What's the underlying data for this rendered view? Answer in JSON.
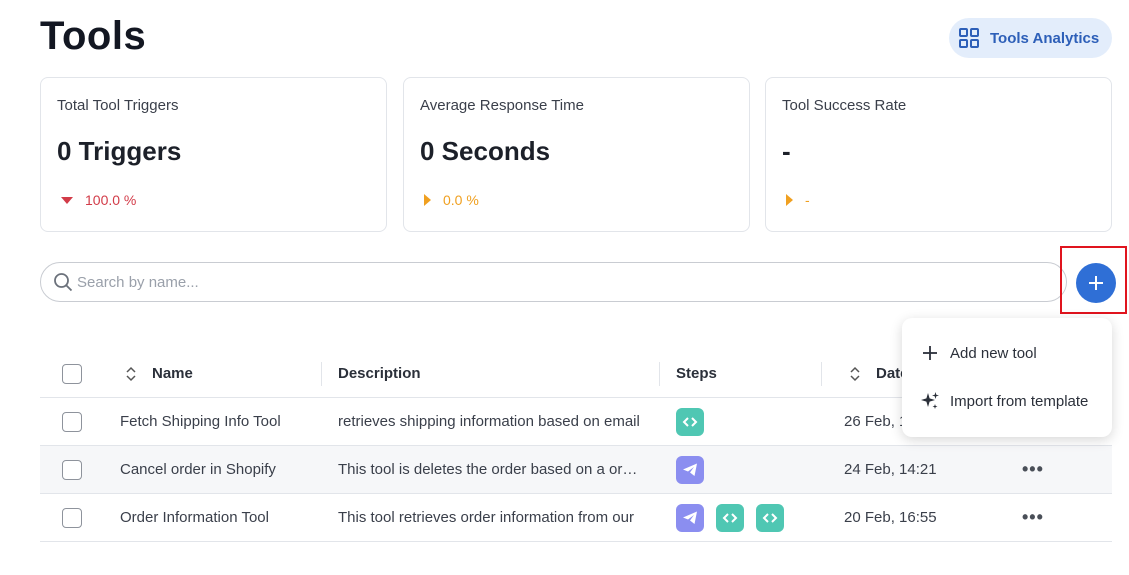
{
  "page": {
    "title": "Tools"
  },
  "header": {
    "analytics_button": "Tools Analytics"
  },
  "stats": [
    {
      "label": "Total Tool Triggers",
      "value": "0 Triggers",
      "delta": "100.0 %",
      "trend": "down",
      "color": "#d23b48"
    },
    {
      "label": "Average Response Time",
      "value": "0 Seconds",
      "delta": "0.0 %",
      "trend": "flat",
      "color": "#f0a020"
    },
    {
      "label": "Tool Success Rate",
      "value": "-",
      "delta": "-",
      "trend": "flat",
      "color": "#f0a020"
    }
  ],
  "search": {
    "placeholder": "Search by name..."
  },
  "add_menu": {
    "items": [
      {
        "label": "Add new tool",
        "icon": "plus-icon"
      },
      {
        "label": "Import from template",
        "icon": "sparkles-icon"
      }
    ]
  },
  "table": {
    "headers": {
      "name": "Name",
      "description": "Description",
      "steps": "Steps",
      "date": "Date"
    },
    "rows": [
      {
        "name": "Fetch Shipping Info Tool",
        "description": "retrieves shipping information based on email",
        "steps": [
          "code"
        ],
        "date": "26 Feb, 1"
      },
      {
        "name": "Cancel order in Shopify",
        "description": "This tool is deletes the order based on a order",
        "steps": [
          "send"
        ],
        "date": "24 Feb, 14:21"
      },
      {
        "name": "Order Information Tool",
        "description": "This tool retrieves order information from our",
        "steps": [
          "send",
          "code",
          "code"
        ],
        "date": "20 Feb, 16:55"
      }
    ]
  },
  "colors": {
    "accent": "#2f6fd6",
    "highlight": "#e0141e",
    "code_step": "#4fc7b3",
    "send_step": "#8b8ef0"
  }
}
